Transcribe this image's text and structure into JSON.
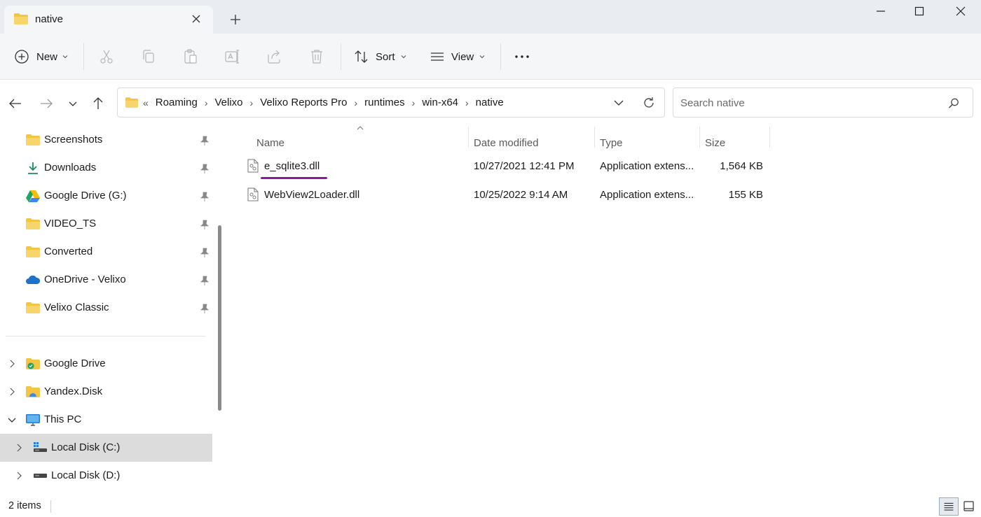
{
  "window": {
    "tab_title": "native",
    "minimize_icon": "minimize-icon",
    "maximize_icon": "maximize-icon",
    "close_icon": "close-icon"
  },
  "toolbar": {
    "new_label": "New",
    "sort_label": "Sort",
    "view_label": "View",
    "more_icon": "more-icon"
  },
  "address": {
    "crumbs": [
      "Roaming",
      "Velixo",
      "Velixo Reports Pro",
      "runtimes",
      "win-x64",
      "native"
    ],
    "overflow": "«"
  },
  "search": {
    "placeholder": "Search native"
  },
  "sidebar": {
    "quick_access": [
      {
        "label": "Screenshots",
        "icon": "folder-icon"
      },
      {
        "label": "Downloads",
        "icon": "download-icon"
      },
      {
        "label": "Google Drive (G:)",
        "icon": "google-drive-icon"
      },
      {
        "label": "VIDEO_TS",
        "icon": "folder-icon"
      },
      {
        "label": "Converted",
        "icon": "folder-icon"
      },
      {
        "label": "OneDrive - Velixo",
        "icon": "onedrive-icon"
      },
      {
        "label": "Velixo Classic",
        "icon": "folder-icon"
      }
    ],
    "tree": [
      {
        "label": "Google Drive",
        "icon": "google-drive-folder-icon"
      },
      {
        "label": "Yandex.Disk",
        "icon": "yandex-disk-icon"
      },
      {
        "label": "This PC",
        "icon": "pc-icon"
      },
      {
        "label": "Local Disk (C:)",
        "icon": "windows-disk-icon"
      },
      {
        "label": "Local Disk (D:)",
        "icon": "disk-icon"
      }
    ]
  },
  "columns": {
    "name": "Name",
    "date": "Date modified",
    "type": "Type",
    "size": "Size"
  },
  "files": [
    {
      "name": "e_sqlite3.dll",
      "date": "10/27/2021 12:41 PM",
      "type": "Application extens...",
      "size": "1,564 KB"
    },
    {
      "name": "WebView2Loader.dll",
      "date": "10/25/2022 9:14 AM",
      "type": "Application extens...",
      "size": "155 KB"
    }
  ],
  "status": {
    "item_count": "2 items"
  },
  "colors": {
    "accent": "#8b1a9b",
    "folder": "#f4c542",
    "selection": "#dcdcdc"
  }
}
